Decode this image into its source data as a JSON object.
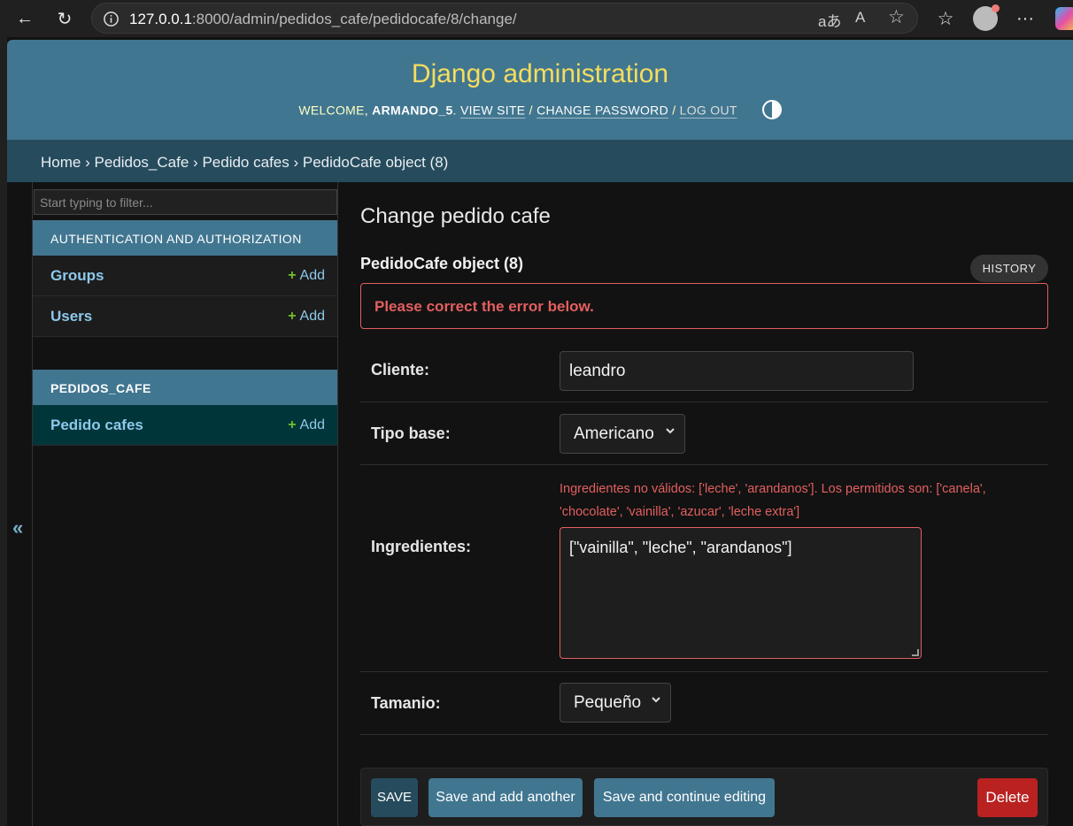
{
  "browser": {
    "back_icon": "←",
    "reload_icon": "↻",
    "url_host": "127.0.0.1",
    "url_rest": ":8000/admin/pedidos_cafe/pedidocafe/8/change/",
    "read_aloud_icon": "A",
    "translate_icon": "aあ",
    "favorite_icon": "☆",
    "favorites_icon": "☆",
    "more_icon": "···"
  },
  "header": {
    "site_title": "Django administration",
    "welcome": "WELCOME,",
    "username": "ARMANDO_5",
    "view_site": "VIEW SITE",
    "change_password": "CHANGE PASSWORD",
    "logout": "LOG OUT",
    "sep": "/",
    "dot": "."
  },
  "breadcrumbs": {
    "home": "Home",
    "app": "Pedidos_Cafe",
    "model": "Pedido cafes",
    "object": "PedidoCafe object (8)",
    "sep": "›"
  },
  "sidebar": {
    "filter_placeholder": "Start typing to filter...",
    "collapse_icon": "«",
    "apps": [
      {
        "caption": "AUTHENTICATION AND AUTHORIZATION",
        "models": [
          {
            "name": "Groups",
            "add": "Add"
          },
          {
            "name": "Users",
            "add": "Add"
          }
        ]
      },
      {
        "caption": "PEDIDOS_CAFE",
        "models": [
          {
            "name": "Pedido cafes",
            "add": "Add"
          }
        ]
      }
    ],
    "plus": "+"
  },
  "content": {
    "title": "Change pedido cafe",
    "object_title": "PedidoCafe object (8)",
    "history": "HISTORY",
    "errornote": "Please correct the error below."
  },
  "form": {
    "cliente_label": "Cliente:",
    "cliente_value": "leandro",
    "tipo_base_label": "Tipo base:",
    "tipo_base_value": "Americano",
    "ingredientes_label": "Ingredientes:",
    "ingredientes_error": "Ingredientes no válidos: ['leche', 'arandanos']. Los permitidos son: ['canela', 'chocolate', 'vainilla', 'azucar', 'leche extra']",
    "ingredientes_value": "[\"vainilla\", \"leche\", \"arandanos\"]",
    "tamanio_label": "Tamanio:",
    "tamanio_value": "Pequeño",
    "chevron": "⌄"
  },
  "submit": {
    "save": "SAVE",
    "save_add_another": "Save and add another",
    "save_continue": "Save and continue editing",
    "delete": "Delete"
  }
}
